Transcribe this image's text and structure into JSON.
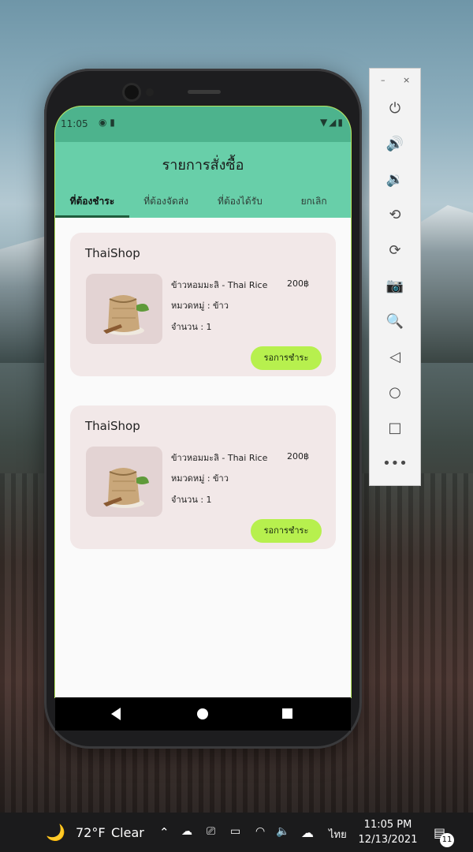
{
  "status_bar": {
    "time": "11:05",
    "left_icons": "◉ ▮",
    "right_icons": "▼◢▮"
  },
  "app": {
    "title": "รายการสั่งซื้อ"
  },
  "tabs": [
    {
      "label": "ที่ต้องชำระ",
      "active": true
    },
    {
      "label": "ที่ต้องจัดส่ง"
    },
    {
      "label": "ที่ต้องได้รับ"
    },
    {
      "label": "ยกเลิก"
    }
  ],
  "orders": [
    {
      "shop": "ThaiShop",
      "product": "ข้าวหอมมะลิ - Thai Rice",
      "price": "200฿",
      "category": "หมวดหมู่ : ข้าว",
      "quantity": "จำนวน : 1",
      "button": "รอการชำระ"
    },
    {
      "shop": "ThaiShop",
      "product": "ข้าวหอมมะลิ - Thai Rice",
      "price": "200฿",
      "category": "หมวดหมู่ : ข้าว",
      "quantity": "จำนวน : 1",
      "button": "รอการชำระ"
    }
  ],
  "emulator_panel": {
    "minimize": "–",
    "close": "×",
    "buttons": [
      "power-icon",
      "volume-up-icon",
      "volume-down-icon",
      "rotate-left-icon",
      "rotate-right-icon",
      "camera-icon",
      "zoom-icon",
      "back-icon",
      "home-icon",
      "overview-icon",
      "more-icon"
    ],
    "glyphs": [
      "⏻",
      "🔊",
      "🔉",
      "⟲",
      "⟳",
      "📷",
      "🔍",
      "◁",
      "○",
      "□",
      "•••"
    ]
  },
  "taskbar": {
    "weather_icon": "🌙",
    "temp": "72°F",
    "condition": "Clear",
    "lang": "ไทย",
    "time": "11:05 PM",
    "date": "12/13/2021",
    "notifications": "11"
  },
  "colors": {
    "status_bar": "#4db38d",
    "app_bar": "#68cfa9",
    "card": "#f2e8e8",
    "button": "#b7f04e"
  }
}
